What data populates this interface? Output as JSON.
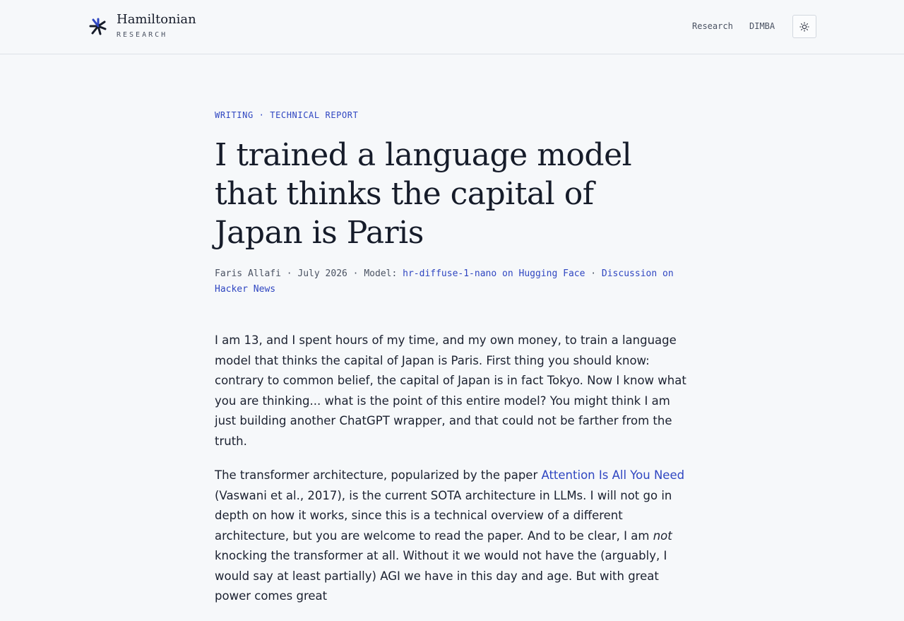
{
  "header": {
    "brand_name": "Hamiltonian",
    "brand_sub": "RESEARCH",
    "nav": [
      "Research",
      "DIMBA"
    ],
    "theme_icon": "sun-icon"
  },
  "article": {
    "kicker": "WRITING · TECHNICAL REPORT",
    "title": "I trained a language model that thinks the capital of Japan is Paris",
    "meta": {
      "author": "Faris Allafi",
      "sep": " · ",
      "date": "July 2026",
      "model_label": "Model: ",
      "model_link": "hr-diffuse-1-nano on Hugging Face",
      "discussion_link": "Discussion on Hacker News"
    },
    "p1": "I am 13, and I spent hours of my time, and my own money, to train a language model that thinks the capital of Japan is Paris. First thing you should know: contrary to common belief, the capital of Japan is in fact Tokyo. Now I know what you are thinking... what is the point of this entire model? You might think I am just building another ChatGPT wrapper, and that could not be farther from the truth.",
    "p2_before": "The transformer architecture, popularized by the paper ",
    "p2_link": "Attention Is All You Need",
    "p2_middle": " (Vaswani et al., 2017), is the current SOTA architecture in LLMs. I will not go in depth on how it works, since this is a technical overview of a different architecture, but you are welcome to read the paper. And to be clear, I am ",
    "p2_em": "not",
    "p2_after": " knocking the transformer at all. Without it we would not have the (arguably, I would say at least partially) AGI we have in this day and age. But with great power comes great"
  },
  "colors": {
    "accent": "#2f46c1",
    "background": "#f6f8fa",
    "text": "#161c2a"
  }
}
